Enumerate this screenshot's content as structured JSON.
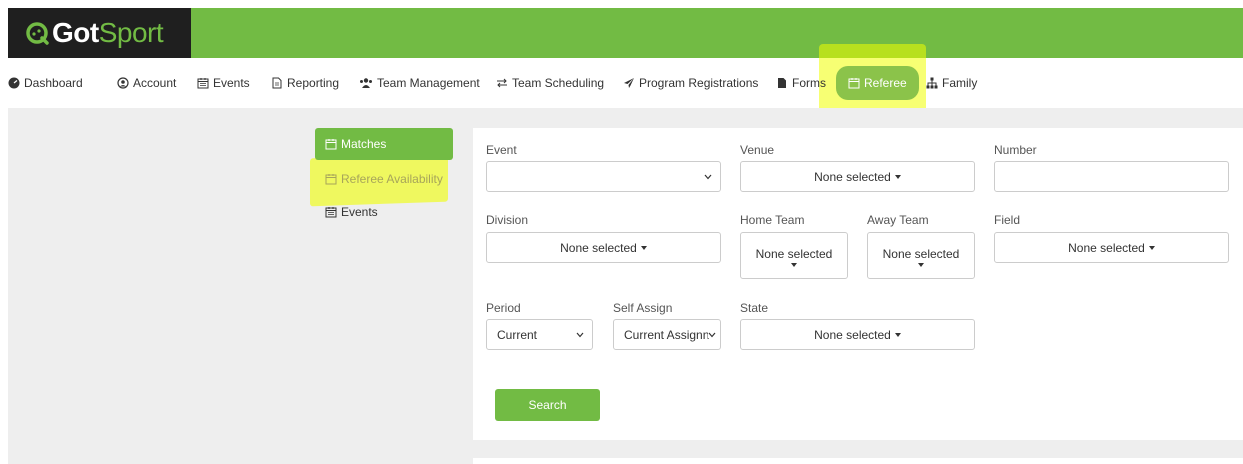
{
  "brand": {
    "logo_got": "Got",
    "logo_sport": "Sport",
    "green": "#72bb44",
    "dark": "#1f1f1f"
  },
  "nav": {
    "items": [
      {
        "label": "Dashboard",
        "icon": "tachometer-icon"
      },
      {
        "label": "Account",
        "icon": "user-circle-icon"
      },
      {
        "label": "Events",
        "icon": "calendar-icon"
      },
      {
        "label": "Reporting",
        "icon": "file-icon"
      },
      {
        "label": "Team Management",
        "icon": "users-icon"
      },
      {
        "label": "Team Scheduling",
        "icon": "exchange-icon"
      },
      {
        "label": "Program Registrations",
        "icon": "paper-plane-icon"
      },
      {
        "label": "Forms",
        "icon": "file-solid-icon"
      },
      {
        "label": "Referee",
        "icon": "calendar-outline-icon",
        "active": true
      },
      {
        "label": "Family",
        "icon": "sitemap-icon"
      }
    ]
  },
  "submenu": {
    "items": [
      {
        "label": "Matches",
        "active": true
      },
      {
        "label": "Referee Availability"
      },
      {
        "label": "Events"
      }
    ]
  },
  "filters": {
    "event": {
      "label": "Event",
      "value": ""
    },
    "venue": {
      "label": "Venue",
      "value": "None selected"
    },
    "number": {
      "label": "Number",
      "value": ""
    },
    "division": {
      "label": "Division",
      "value": "None selected"
    },
    "home_team": {
      "label": "Home Team",
      "value": "None selected"
    },
    "away_team": {
      "label": "Away Team",
      "value": "None selected"
    },
    "field": {
      "label": "Field",
      "value": "None selected"
    },
    "period": {
      "label": "Period",
      "value": "Current"
    },
    "self_assign": {
      "label": "Self Assign",
      "value": "Current Assignn"
    },
    "state": {
      "label": "State",
      "value": "None selected"
    },
    "search_label": "Search"
  }
}
